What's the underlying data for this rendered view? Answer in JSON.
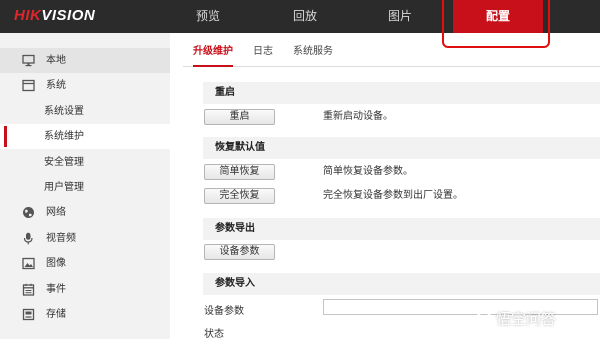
{
  "header": {
    "logo": {
      "hik": "HIK",
      "vision": "VISION"
    },
    "nav": [
      {
        "label": "预览"
      },
      {
        "label": "回放"
      },
      {
        "label": "图片"
      },
      {
        "label": "配置"
      }
    ],
    "active_nav": "配置"
  },
  "sidebar": {
    "items": [
      {
        "label": "本地",
        "icon": "monitor-icon"
      },
      {
        "label": "系统",
        "icon": "system-icon"
      },
      {
        "label": "系统设置"
      },
      {
        "label": "系统维护"
      },
      {
        "label": "安全管理"
      },
      {
        "label": "用户管理"
      },
      {
        "label": "网络",
        "icon": "globe-icon"
      },
      {
        "label": "视音频",
        "icon": "microphone-icon"
      },
      {
        "label": "图像",
        "icon": "image-icon"
      },
      {
        "label": "事件",
        "icon": "calendar-icon"
      },
      {
        "label": "存储",
        "icon": "storage-icon"
      }
    ],
    "active_item": "系统维护"
  },
  "tabs": [
    {
      "label": "升级维护"
    },
    {
      "label": "日志"
    },
    {
      "label": "系统服务"
    }
  ],
  "sections": {
    "reboot": {
      "title": "重启",
      "button": "重启",
      "description": "重新启动设备。"
    },
    "restore": {
      "title": "恢复默认值",
      "simple_button": "简单恢复",
      "simple_description": "简单恢复设备参数。",
      "full_button": "完全恢复",
      "full_description": "完全恢复设备参数到出厂设置。"
    },
    "export": {
      "title": "参数导出",
      "button": "设备参数"
    },
    "import": {
      "title": "参数导入",
      "field_label": "设备参数",
      "field_value": "",
      "status_label": "状态"
    }
  },
  "watermark": {
    "text": "悟空问答"
  },
  "colors": {
    "accent": "#c8101a",
    "topbar": "#2b2b2b",
    "sidebar": "#f2f2f2",
    "annotation": "#e01010"
  }
}
